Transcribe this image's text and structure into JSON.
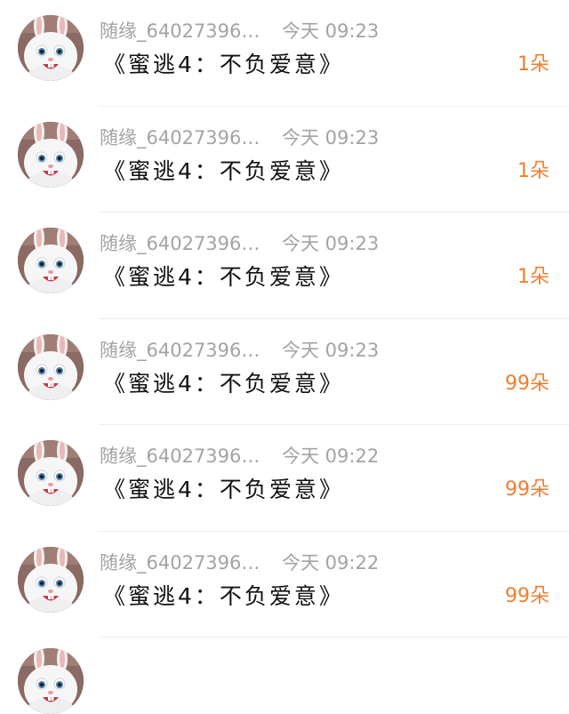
{
  "icons": {
    "avatar": "white-rabbit-avatar"
  },
  "colors": {
    "meta_text": "#a3a3a3",
    "title_text": "#111111",
    "amount_text": "#ee7f2e",
    "divider": "#eeeeee"
  },
  "items": [
    {
      "user": "随缘_64027396…",
      "time": "今天 09:23",
      "title": "《蜜逃4：不负爱意》",
      "amount": "1朵"
    },
    {
      "user": "随缘_64027396…",
      "time": "今天 09:23",
      "title": "《蜜逃4：不负爱意》",
      "amount": "1朵"
    },
    {
      "user": "随缘_64027396…",
      "time": "今天 09:23",
      "title": "《蜜逃4：不负爱意》",
      "amount": "1朵"
    },
    {
      "user": "随缘_64027396…",
      "time": "今天 09:23",
      "title": "《蜜逃4：不负爱意》",
      "amount": "99朵"
    },
    {
      "user": "随缘_64027396…",
      "time": "今天 09:22",
      "title": "《蜜逃4：不负爱意》",
      "amount": "99朵"
    },
    {
      "user": "随缘_64027396…",
      "time": "今天 09:22",
      "title": "《蜜逃4：不负爱意》",
      "amount": "99朵"
    }
  ]
}
